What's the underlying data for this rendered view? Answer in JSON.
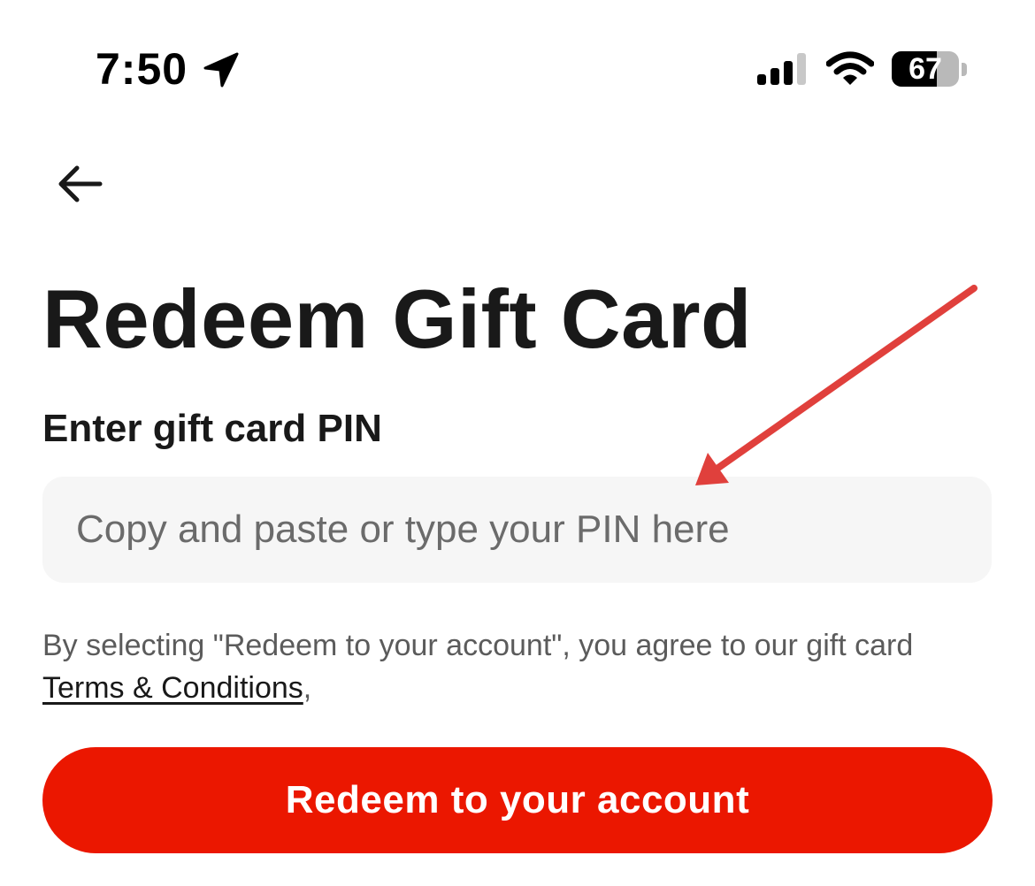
{
  "status_bar": {
    "time": "7:50",
    "battery_level": "67",
    "battery_fraction": 0.67,
    "icons": [
      "location-arrow-icon",
      "cellular-signal-icon",
      "wifi-icon",
      "battery-icon"
    ]
  },
  "nav": {
    "back_icon": "arrow-left-icon"
  },
  "page": {
    "title": "Redeem Gift Card"
  },
  "pin_field": {
    "label": "Enter gift card PIN",
    "value": "",
    "placeholder": "Copy and paste or type your PIN here"
  },
  "terms": {
    "prefix": "By selecting \"Redeem to your account\", you agree to our gift card ",
    "link_label": "Terms & Conditions",
    "suffix": ","
  },
  "redeem_button": {
    "label": "Redeem to your account"
  },
  "colors": {
    "primary": "#eb1700",
    "annotation_arrow": "#e0403c",
    "input_background": "#f6f6f6",
    "text_primary": "#191919",
    "text_secondary": "#5b5b5b"
  }
}
